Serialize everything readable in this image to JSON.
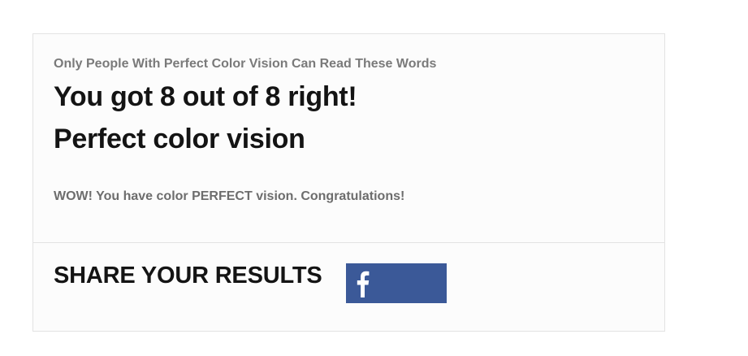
{
  "quiz": {
    "title": "Only People With Perfect Color Vision Can Read These Words"
  },
  "result": {
    "score_text": "You got 8 out of 8 right!",
    "name": "Perfect color vision",
    "description": "WOW! You have color PERFECT vision. Congratulations!"
  },
  "share": {
    "label": "SHARE YOUR RESULTS",
    "facebook_icon": "facebook-f-icon",
    "facebook_color": "#3b5998"
  }
}
